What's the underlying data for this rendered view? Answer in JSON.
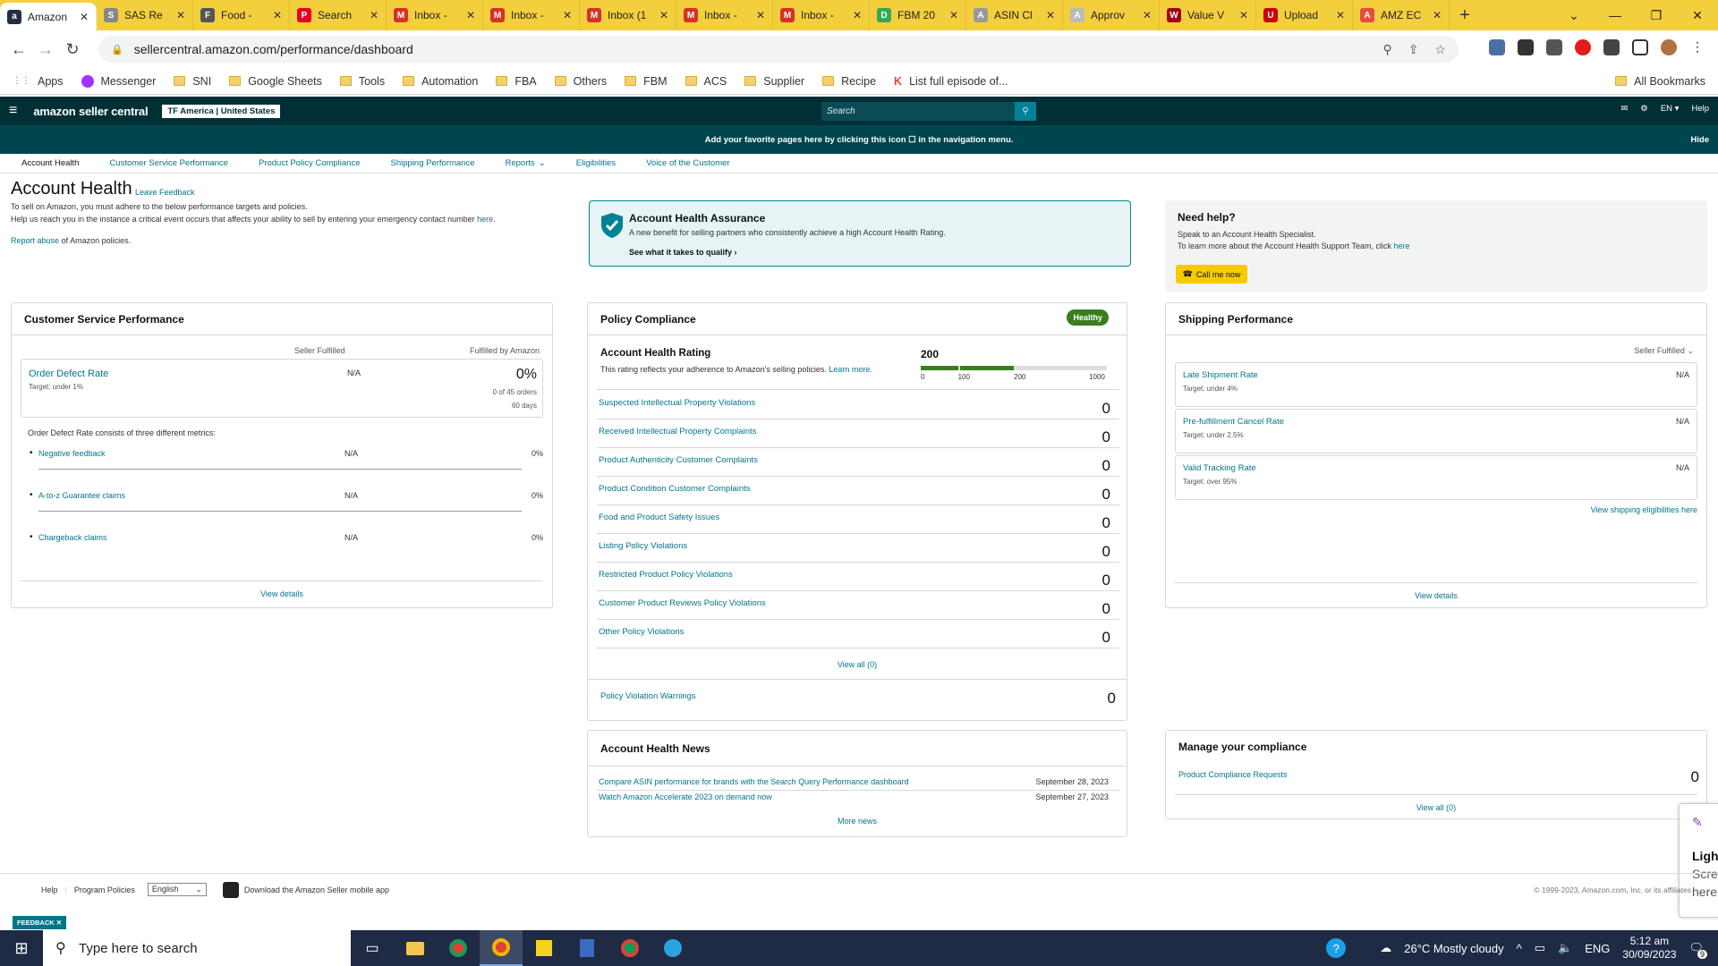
{
  "browser": {
    "tabs": [
      {
        "title": "Amazon",
        "icon": "amazon-icon",
        "color": "#232f3e",
        "letter": "a"
      },
      {
        "title": "SAS Re",
        "icon": "sas-icon",
        "color": "#888888",
        "letter": "S"
      },
      {
        "title": "Food -",
        "icon": "globe-icon",
        "color": "#555555",
        "letter": "F"
      },
      {
        "title": "Search",
        "icon": "pinterest-icon",
        "color": "#e60023",
        "letter": "P"
      },
      {
        "title": "Inbox -",
        "icon": "gmail-icon",
        "color": "#d93025",
        "letter": "M"
      },
      {
        "title": "Inbox -",
        "icon": "gmail-icon",
        "color": "#d93025",
        "letter": "M"
      },
      {
        "title": "Inbox (1",
        "icon": "gmail-icon",
        "color": "#d93025",
        "letter": "M"
      },
      {
        "title": "Inbox -",
        "icon": "gmail-icon",
        "color": "#d93025",
        "letter": "M"
      },
      {
        "title": "Inbox -",
        "icon": "gmail-icon",
        "color": "#d93025",
        "letter": "M"
      },
      {
        "title": "FBM 20",
        "icon": "drive-icon",
        "color": "#34a853",
        "letter": "D"
      },
      {
        "title": "ASIN Cl",
        "icon": "asin-icon",
        "color": "#999999",
        "letter": "A"
      },
      {
        "title": "Approv",
        "icon": "approve-icon",
        "color": "#bbbbbb",
        "letter": "A"
      },
      {
        "title": "Value V",
        "icon": "value-icon",
        "color": "#a4000f",
        "letter": "W"
      },
      {
        "title": "Upload",
        "icon": "upload-icon",
        "color": "#cc0000",
        "letter": "U"
      },
      {
        "title": "AMZ EC",
        "icon": "amz-icon",
        "color": "#e74c3c",
        "letter": "A"
      }
    ],
    "url": "sellercentral.amazon.com/performance/dashboard",
    "bookmarks": [
      "Apps",
      "Messenger",
      "SNI",
      "Google Sheets",
      "Tools",
      "Automation",
      "FBA",
      "Others",
      "FBM",
      "ACS",
      "Supplier",
      "Recipe",
      "List full episode of..."
    ],
    "all_bookmarks": "All Bookmarks"
  },
  "sc": {
    "logo": "amazon seller central",
    "store": "TF America | United States",
    "search_placeholder": "Search",
    "lang": "EN",
    "help": "Help",
    "banner": "Add your favorite pages here by clicking this icon ☐ in the navigation menu.",
    "banner_hide": "Hide",
    "subnav": [
      "Account Health",
      "Customer Service Performance",
      "Product Policy Compliance",
      "Shipping Performance",
      "Reports",
      "Eligibilities",
      "Voice of the Customer"
    ]
  },
  "ah": {
    "title": "Account Health",
    "feedback": "Leave Feedback",
    "line1": "To sell on Amazon, you must adhere to the below performance targets and policies.",
    "line2": "Help us reach you in the instance a critical event occurs that affects your ability to sell by entering your emergency contact number",
    "line2_link": "here.",
    "report_link": "Report abuse",
    "report_text": "of Amazon policies."
  },
  "assurance": {
    "title": "Account Health Assurance",
    "desc": "A new benefit for selling partners who consistently achieve a high Account Health Rating.",
    "link": "See what it takes to qualify"
  },
  "needhelp": {
    "title": "Need help?",
    "line1": "Speak to an Account Health Specialist.",
    "line2": "To learn more about the Account Health Support Team, click",
    "line2_link": "here",
    "button": "Call me now"
  },
  "csp": {
    "title": "Customer Service Performance",
    "col1": "Seller Fulfilled",
    "col2": "Fulfilled by Amazon",
    "odr_label": "Order Defect Rate",
    "odr_target": "Target: under 1%",
    "odr_sf": "N/A",
    "odr_fba": "0%",
    "odr_fba_orders": "0 of 45 orders",
    "odr_fba_days": "60 days",
    "consists": "Order Defect Rate consists of three different metrics:",
    "metrics": [
      {
        "name": "Negative feedback",
        "sf": "N/A",
        "fba": "0%"
      },
      {
        "name": "A-to-z Guarantee claims",
        "sf": "N/A",
        "fba": "0%"
      },
      {
        "name": "Chargeback claims",
        "sf": "N/A",
        "fba": "0%"
      }
    ],
    "view": "View details"
  },
  "pc": {
    "title": "Policy Compliance",
    "badge": "Healthy",
    "ahr_title": "Account Health Rating",
    "ahr_desc": "This rating reflects your adherence to Amazon's selling policies.",
    "ahr_learn": "Learn more.",
    "ahr_value": "200",
    "ahr_fraction": 0.2,
    "ticks": [
      "0",
      "100",
      "200",
      "1000"
    ],
    "rows": [
      {
        "name": "Suspected Intellectual Property Violations",
        "value": "0"
      },
      {
        "name": "Received Intellectual Property Complaints",
        "value": "0"
      },
      {
        "name": "Product Authenticity Customer Complaints",
        "value": "0"
      },
      {
        "name": "Product Condition Customer Complaints",
        "value": "0"
      },
      {
        "name": "Food and Product Safety Issues",
        "value": "0"
      },
      {
        "name": "Listing Policy Violations",
        "value": "0"
      },
      {
        "name": "Restricted Product Policy Violations",
        "value": "0"
      },
      {
        "name": "Customer Product Reviews Policy Violations",
        "value": "0"
      },
      {
        "name": "Other Policy Violations",
        "value": "0"
      }
    ],
    "view_all": "View all (0)",
    "warnings": "Policy Violation Warnings",
    "warnings_value": "0"
  },
  "news": {
    "title": "Account Health News",
    "items": [
      {
        "text": "Compare ASIN performance for brands with the Search Query Performance dashboard",
        "date": "September 28, 2023"
      },
      {
        "text": "Watch Amazon Accelerate 2023 on demand now",
        "date": "September 27, 2023"
      }
    ],
    "more": "More news"
  },
  "sp": {
    "title": "Shipping Performance",
    "filter": "Seller Fulfilled",
    "rows": [
      {
        "name": "Late Shipment Rate",
        "target": "Target: under 4%",
        "value": "N/A"
      },
      {
        "name": "Pre-fulfillment Cancel Rate",
        "target": "Target: under 2.5%",
        "value": "N/A"
      },
      {
        "name": "Valid Tracking Rate",
        "target": "Target: over 95%",
        "value": "N/A"
      }
    ],
    "elig": "View shipping eligibilities here",
    "view": "View details"
  },
  "mc": {
    "title": "Manage your compliance",
    "row": "Product Compliance Requests",
    "value": "0",
    "view": "View all (0)"
  },
  "footer": {
    "help": "Help",
    "policies": "Program Policies",
    "lang": "English",
    "app": "Download the Amazon Seller mobile app",
    "copyright": "© 1999-2023, Amazon.com, Inc. or its affiliates"
  },
  "feedback_tab": "FEEDBACK",
  "side_popup": [
    "Ligh",
    "Scre",
    "here"
  ],
  "taskbar": {
    "search": "Type here to search",
    "weather": "26°C  Mostly cloudy",
    "lang": "ENG",
    "time": "5:12 am",
    "date": "30/09/2023",
    "badge": "9"
  }
}
